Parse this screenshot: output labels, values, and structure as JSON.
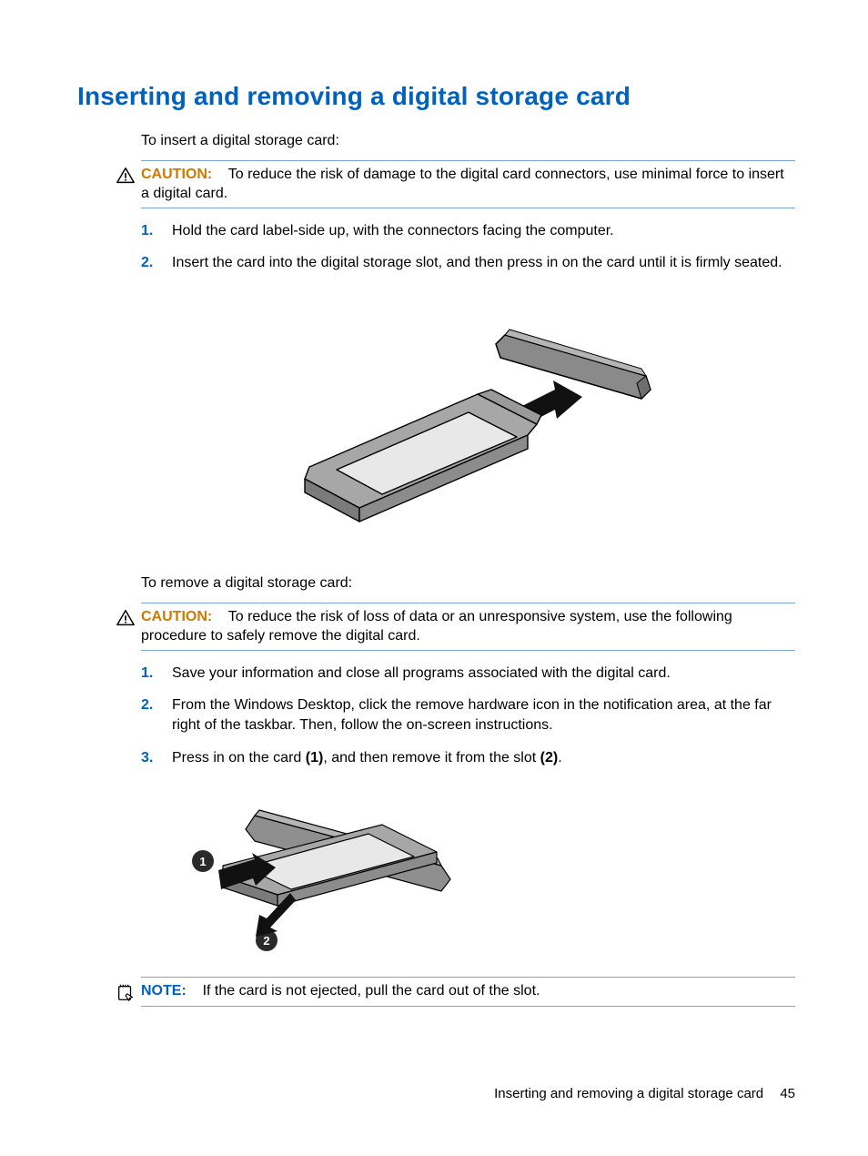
{
  "title": "Inserting and removing a digital storage card",
  "intro_insert": "To insert a digital storage card:",
  "caution1": {
    "label": "CAUTION:",
    "text": "To reduce the risk of damage to the digital card connectors, use minimal force to insert a digital card."
  },
  "insert_steps": [
    {
      "num": "1.",
      "text": "Hold the card label-side up, with the connectors facing the computer."
    },
    {
      "num": "2.",
      "text": "Insert the card into the digital storage slot, and then press in on the card until it is firmly seated."
    }
  ],
  "intro_remove": "To remove a digital storage card:",
  "caution2": {
    "label": "CAUTION:",
    "text": "To reduce the risk of loss of data or an unresponsive system, use the following procedure to safely remove the digital card."
  },
  "remove_steps": [
    {
      "num": "1.",
      "text": "Save your information and close all programs associated with the digital card."
    },
    {
      "num": "2.",
      "text": "From the Windows Desktop, click the remove hardware icon in the notification area, at the far right of the taskbar. Then, follow the on-screen instructions."
    },
    {
      "num": "3.",
      "prefix": "Press in on the card ",
      "b1": "(1)",
      "mid": ", and then remove it from the slot ",
      "b2": "(2)",
      "suffix": "."
    }
  ],
  "note": {
    "label": "NOTE:",
    "text": "If the card is not ejected, pull the card out of the slot."
  },
  "footer": {
    "title": "Inserting and removing a digital storage card",
    "page": "45"
  }
}
